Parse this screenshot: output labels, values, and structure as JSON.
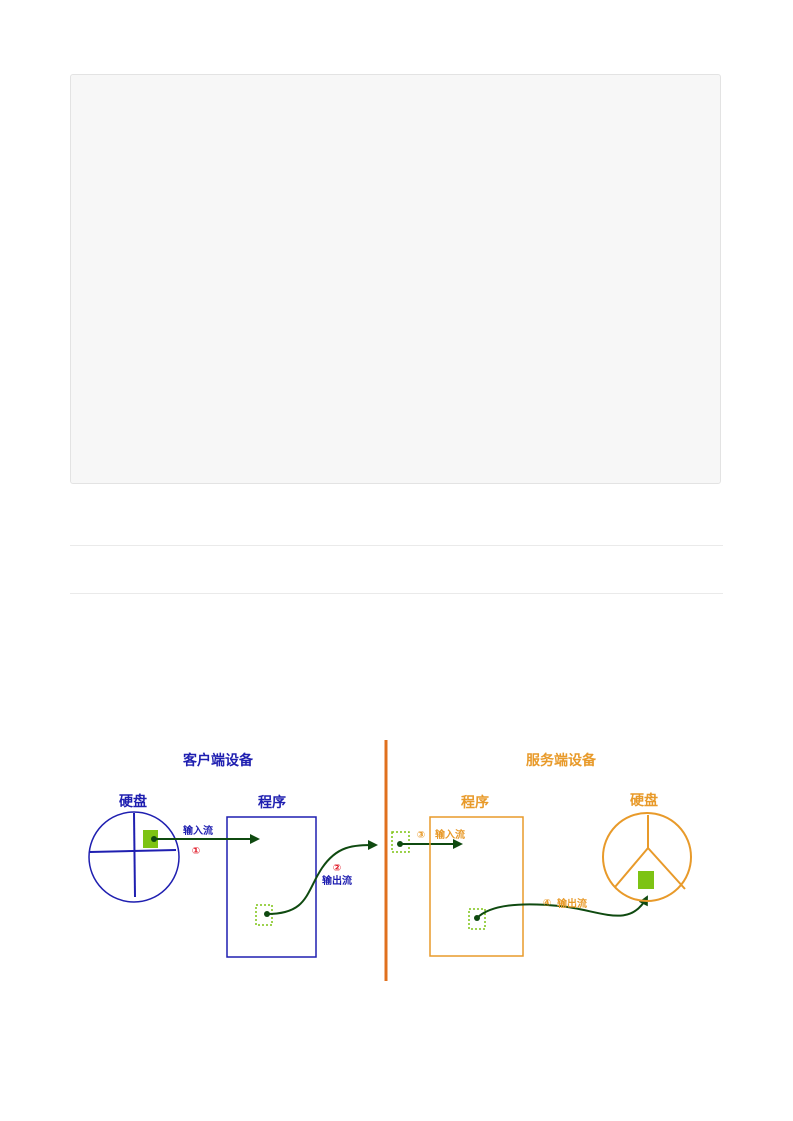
{
  "diagram": {
    "client": {
      "title": "客户端设备",
      "disk_label": "硬盘",
      "program_label": "程序",
      "color": "#1f1fb0"
    },
    "server": {
      "title": "服务端设备",
      "disk_label": "硬盘",
      "program_label": "程序",
      "color": "#e89a2a"
    },
    "divider_color": "#e0701e",
    "arrow_color": "#0f4a10",
    "file_color": "#7dc314",
    "steps": [
      {
        "marker": "①",
        "label": "输入流",
        "marker_color": "#e01c2a",
        "label_color": "#1f1fb0"
      },
      {
        "marker": "②",
        "label": "输出流",
        "marker_color": "#e01c2a",
        "label_color": "#1f1fb0"
      },
      {
        "marker": "③",
        "label": "输入流",
        "marker_color": "#e89a2a",
        "label_color": "#e89a2a"
      },
      {
        "marker": "④",
        "label": "输出流",
        "marker_color": "#e89a2a",
        "label_color": "#e89a2a"
      }
    ]
  }
}
